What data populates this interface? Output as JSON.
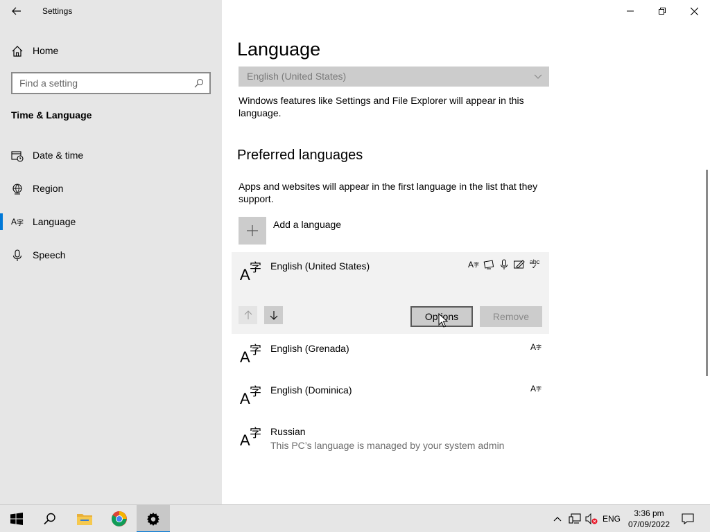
{
  "window": {
    "app_title": "Settings",
    "controls": [
      "minimize-icon",
      "restore-icon",
      "close-icon"
    ]
  },
  "sidebar": {
    "home_label": "Home",
    "search_placeholder": "Find a setting",
    "section_title": "Time & Language",
    "items": [
      {
        "label": "Date & time",
        "icon": "calendar-clock-icon",
        "active": false
      },
      {
        "label": "Region",
        "icon": "globe-icon",
        "active": false
      },
      {
        "label": "Language",
        "icon": "language-icon",
        "active": true
      },
      {
        "label": "Speech",
        "icon": "microphone-icon",
        "active": false
      }
    ]
  },
  "main": {
    "title": "Language",
    "display_language": {
      "value": "English (United States)",
      "description": "Windows features like Settings and File Explorer will appear in this language."
    },
    "preferred": {
      "heading": "Preferred languages",
      "description": "Apps and websites will appear in the first language in the list that they support.",
      "add_label": "Add a language",
      "languages": [
        {
          "name": "English (United States)",
          "subtitle": "",
          "selected": true,
          "features": [
            "language-pack-icon",
            "display-icon",
            "speech-icon",
            "handwriting-icon",
            "spellcheck-icon"
          ]
        },
        {
          "name": "English (Grenada)",
          "subtitle": "",
          "selected": false,
          "features": [
            "language-pack-icon"
          ]
        },
        {
          "name": "English (Dominica)",
          "subtitle": "",
          "selected": false,
          "features": [
            "language-pack-icon"
          ]
        },
        {
          "name": "Russian",
          "subtitle": "This PC’s language is managed by your system admin",
          "selected": false,
          "features": []
        }
      ],
      "options_label": "Options",
      "remove_label": "Remove",
      "feature_glyph": "A字",
      "spellcheck_glyph": "abc"
    }
  },
  "taskbar": {
    "apps": [
      "start-icon",
      "search-icon",
      "file-explorer-icon",
      "chrome-icon",
      "settings-icon"
    ],
    "tray": {
      "language": "ENG",
      "time": "3:36 pm",
      "date": "07/09/2022"
    }
  },
  "colors": {
    "accent": "#0078d7",
    "sidebar_bg": "#e6e6e6",
    "control_bg": "#cccccc"
  }
}
